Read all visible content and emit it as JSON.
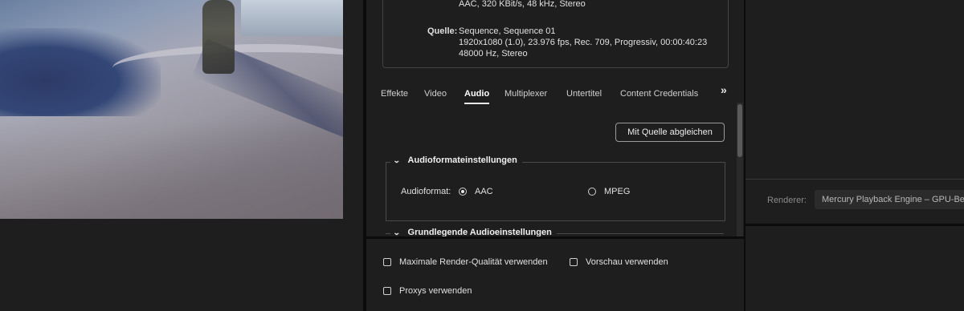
{
  "summary": {
    "output_audio": "AAC, 320 KBit/s, 48 kHz, Stereo",
    "source_label": "Quelle:",
    "source_name": "Sequence, Sequence 01",
    "source_video": "1920x1080 (1.0), 23.976 fps, Rec. 709, Progressiv, 00:00:40:23",
    "source_audio": "48000 Hz, Stereo"
  },
  "tabs": [
    {
      "label": "Effekte"
    },
    {
      "label": "Video"
    },
    {
      "label": "Audio",
      "active": true
    },
    {
      "label": "Multiplexer"
    },
    {
      "label": "Untertitel"
    },
    {
      "label": "Content Credentials"
    }
  ],
  "tabs_overflow_icon": "double-chevron-right-icon",
  "match_source_button": "Mit Quelle abgleichen",
  "audio_format_section": {
    "title": "Audioformateinstellungen",
    "field_label": "Audioformat:",
    "options": [
      {
        "label": "AAC",
        "selected": true
      },
      {
        "label": "MPEG",
        "selected": false
      }
    ]
  },
  "basic_audio_section": {
    "title": "Grundlegende Audioeinstellungen"
  },
  "checkboxes": {
    "max_render_quality": {
      "label": "Maximale Render-Qualität verwenden",
      "checked": false
    },
    "use_preview": {
      "label": "Vorschau verwenden",
      "checked": false
    },
    "use_proxies": {
      "label": "Proxys verwenden",
      "checked": false
    }
  },
  "renderer": {
    "label": "Renderer:",
    "value": "Mercury Playback Engine – GPU-Beschleunigung"
  },
  "colors": {
    "background": "#1e1e1e",
    "panel_border": "#0b0b0b",
    "text": "#e0e0e0"
  }
}
